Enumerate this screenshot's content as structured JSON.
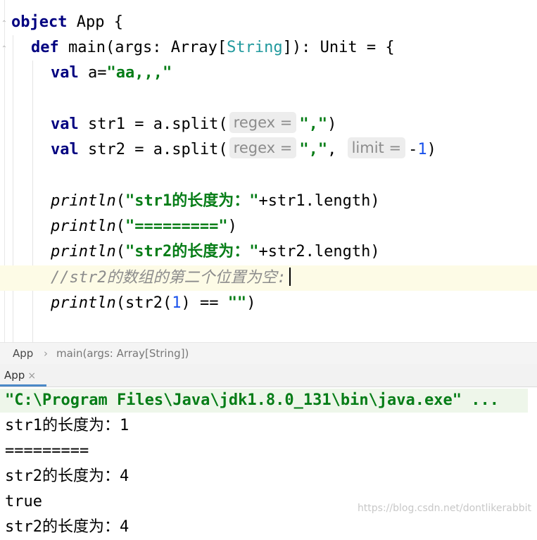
{
  "editor": {
    "code": [
      {
        "k": "object",
        "t": " App {"
      },
      {
        "k": "def",
        "t": " main(args: Array[",
        "ty": "String",
        "t2": "]): Unit = {"
      },
      {
        "k": "val",
        "t": " a=",
        "s": "\"aa,,,\""
      },
      {
        "k": "val",
        "t": " str1 = a.split(",
        "h": "regex =",
        "s": "\",\"",
        "t2": ")"
      },
      {
        "k": "val",
        "t": " str2 = a.split(",
        "h": "regex =",
        "s": "\",\"",
        "t2": ", ",
        "h2": "limit =",
        "t3": "-",
        "n": "1",
        "t4": ")"
      },
      {
        "f": "println",
        "t": "(",
        "s": "\"str1的长度为：\"",
        "t2": "+str1.length)"
      },
      {
        "f": "println",
        "t": "(",
        "s": "\"=========\"",
        "t2": ")"
      },
      {
        "f": "println",
        "t": "(",
        "s": "\"str2的长度为：\"",
        "t2": "+str2.length)"
      },
      {
        "c": "//str2的数组的第二个位置为空:"
      },
      {
        "f": "println",
        "t": "(str2(",
        "n": "1",
        "t2": ") == ",
        "s": "\"\"",
        "t3": ")"
      }
    ]
  },
  "breadcrumb": {
    "file": "App",
    "sep": "›",
    "method": "main(args: Array[String])"
  },
  "run_panel": {
    "tab_label": "App",
    "close_glyph": "×"
  },
  "console": {
    "command": "\"C:\\Program Files\\Java\\jdk1.8.0_131\\bin\\java.exe\" ...",
    "lines": [
      "str1的长度为：1",
      "=========",
      "str2的长度为：4",
      "true",
      "str2的长度为：4"
    ]
  },
  "watermark": "https://blog.csdn.net/dontlikerabbit"
}
